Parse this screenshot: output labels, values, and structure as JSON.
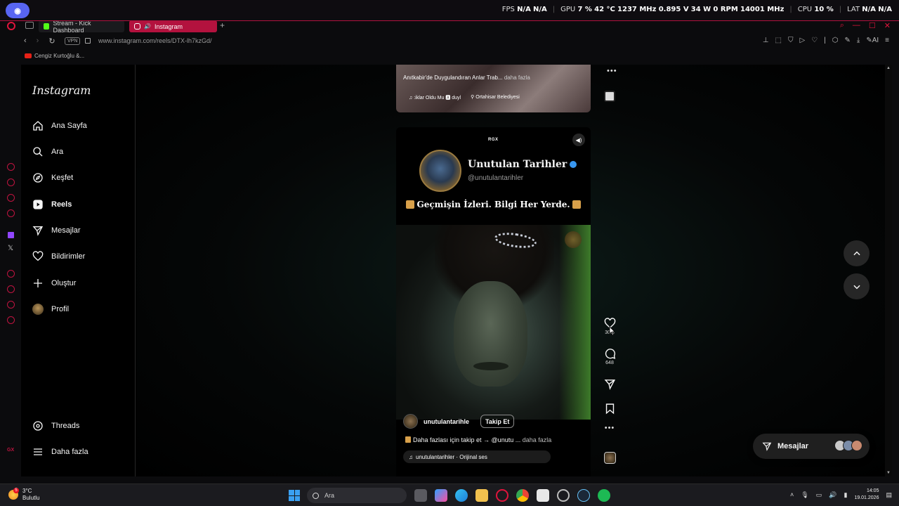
{
  "overlay": {
    "stats": [
      {
        "label": "FPS",
        "values": [
          "N/A",
          "N/A"
        ]
      },
      {
        "label": "GPU",
        "values": [
          "7 %",
          "42 °C",
          "1237 MHz",
          "0.895 V",
          "34 W",
          "0 RPM",
          "14001 MHz"
        ]
      },
      {
        "label": "CPU",
        "values": [
          "10 %"
        ]
      },
      {
        "label": "LAT",
        "values": [
          "N/A",
          "N/A"
        ]
      }
    ]
  },
  "browser": {
    "tabs": [
      {
        "label": "Stream - Kick Dashboard",
        "active": false
      },
      {
        "label": "Instagram",
        "active": true
      }
    ],
    "url": "www.instagram.com/reels/DTX-lh7kzGd/",
    "vpn_label": "VPN",
    "ai_label": "AI",
    "bookmark": "Cengiz Kurtoğlu &...",
    "sidebar_gx": "GX"
  },
  "instagram": {
    "logo": "Instagram",
    "nav": [
      {
        "label": "Ana Sayfa",
        "icon": "home-icon"
      },
      {
        "label": "Ara",
        "icon": "search-icon"
      },
      {
        "label": "Keşfet",
        "icon": "explore-icon"
      },
      {
        "label": "Reels",
        "icon": "reels-icon"
      },
      {
        "label": "Mesajlar",
        "icon": "messages-icon"
      },
      {
        "label": "Bildirimler",
        "icon": "heart-icon"
      },
      {
        "label": "Oluştur",
        "icon": "plus-icon"
      },
      {
        "label": "Profil",
        "icon": "avatar"
      }
    ],
    "nav_bottom": [
      {
        "label": "Threads",
        "icon": "threads-icon"
      },
      {
        "label": "Daha fazla",
        "icon": "menu-icon"
      }
    ],
    "prev_reel": {
      "caption": "Anıtkabir'de Duygulandıran Anlar Trab...",
      "more": "daha fazla",
      "audio": ":iklar Oldu Mu 🅰 duyl",
      "location": "Ortahisar Belediyesi"
    },
    "reel": {
      "brand": "RGX",
      "account_title": "Unutulan Tarihler",
      "account_handle": "@unutulantarihler",
      "tagline": "Geçmişin İzleri. Bilgi Her Yerde.",
      "author": "unutulantarihle",
      "follow_label": "Takip Et",
      "description": "Daha fazlası için takip et → @unutu ...",
      "description_more": "daha fazla",
      "audio": "unutulantarihler · Orijinal ses",
      "likes": "30.8",
      "comments": "648"
    },
    "messages_pill": "Mesajlar"
  },
  "taskbar": {
    "temperature": "3°C",
    "condition": "Bulutlu",
    "weather_badge": "5",
    "search_placeholder": "Ara",
    "time": "14:05",
    "date": "19.01.2026"
  }
}
